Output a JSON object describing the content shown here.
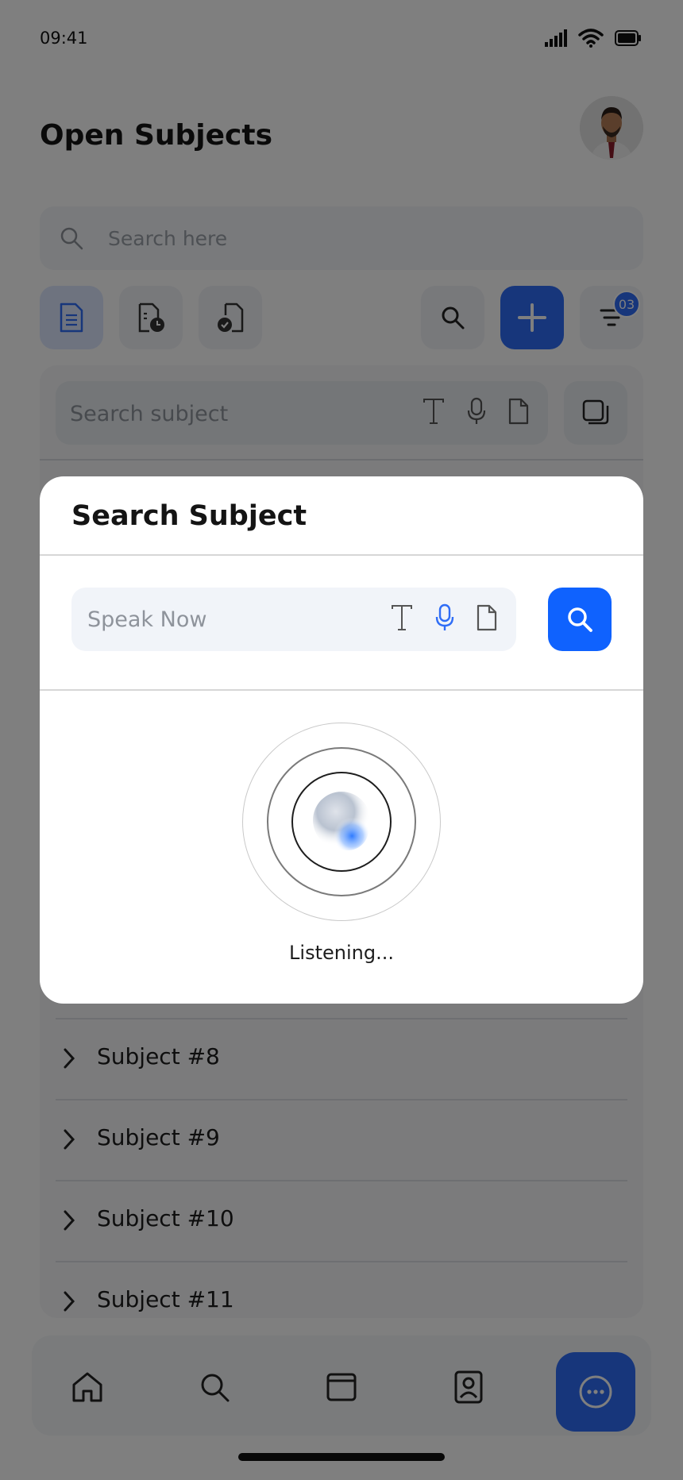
{
  "status_bar": {
    "time": "09:41"
  },
  "page": {
    "title": "Open Subjects"
  },
  "top_search": {
    "placeholder": "Search here"
  },
  "toolbar": {
    "filter_badge": "03"
  },
  "panel": {
    "search_placeholder": "Search subject",
    "subjects": [
      "Subject #8",
      "Subject #9",
      "Subject #10",
      "Subject #11"
    ]
  },
  "modal": {
    "title": "Search Subject",
    "input_placeholder": "Speak Now",
    "status": "Listening..."
  },
  "icons": {
    "status": [
      "signal-icon",
      "wifi-icon",
      "battery-icon"
    ],
    "toolbar": [
      "document-list-icon",
      "document-clock-icon",
      "document-check-icon",
      "search-icon",
      "plus-icon",
      "filter-icon"
    ],
    "input_modes": [
      "text-icon",
      "microphone-icon",
      "file-icon"
    ],
    "nav": [
      "home-icon",
      "search-icon",
      "window-icon",
      "contacts-icon",
      "chat-more-icon"
    ]
  },
  "colors": {
    "accent": "#2f6df6",
    "modal_button": "#0f62fe",
    "active_mic": "#2f6df6"
  }
}
